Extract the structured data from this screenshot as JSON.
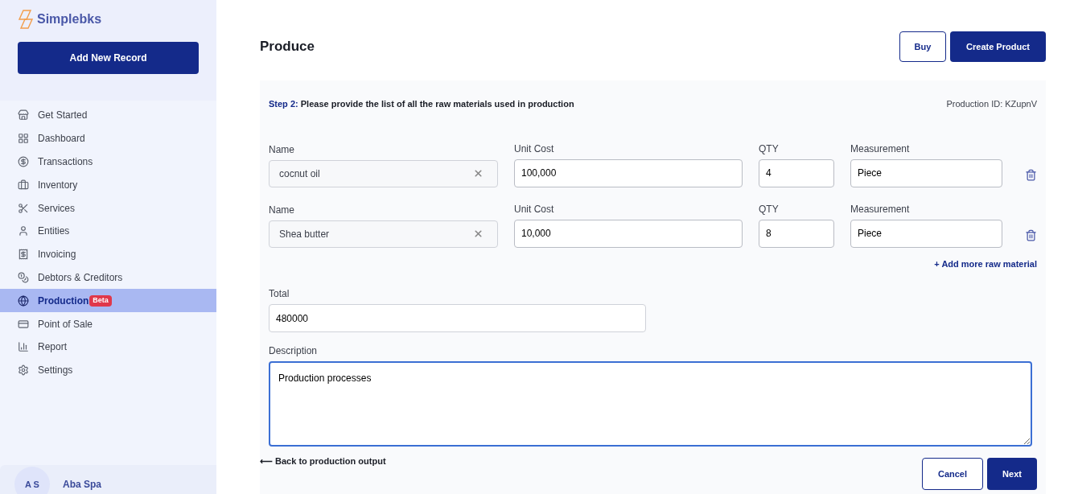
{
  "sidebar": {
    "brand": "Simplebks",
    "add_button": "Add New Record",
    "items": [
      {
        "label": "Get Started",
        "selected": false
      },
      {
        "label": "Dashboard",
        "selected": false
      },
      {
        "label": "Transactions",
        "selected": false
      },
      {
        "label": "Inventory",
        "selected": false
      },
      {
        "label": "Services",
        "selected": false
      },
      {
        "label": "Entities",
        "selected": false
      },
      {
        "label": "Invoicing",
        "selected": false
      },
      {
        "label": "Debtors & Creditors",
        "selected": false
      },
      {
        "label": "Production",
        "selected": true,
        "badge": "Beta"
      },
      {
        "label": "Point of Sale",
        "selected": false
      },
      {
        "label": "Report",
        "selected": false
      },
      {
        "label": "Settings",
        "selected": false
      }
    ],
    "user": {
      "initials": "A S",
      "name": "Aba Spa"
    }
  },
  "header": {
    "title": "Produce",
    "buttons": [
      "Buy",
      "Create Product"
    ]
  },
  "form": {
    "step_label": "Step 2:",
    "instruction": "Please provide the list of all the raw materials used in production",
    "production_id": "Production ID: KZupnV",
    "materials": [
      {
        "name_label": "Name",
        "name": "cocnut oil",
        "unit_cost_label": "Unit Cost",
        "unit_cost": "100,000",
        "qty_label": "QTY",
        "qty": "4",
        "measurement_label": "Measurement",
        "measurement": "Piece"
      },
      {
        "name_label": "Name",
        "name": "Shea butter",
        "unit_cost_label": "Unit Cost",
        "unit_cost": "10,000",
        "qty_label": "QTY",
        "qty": "8",
        "measurement_label": "Measurement",
        "measurement": "Piece"
      }
    ],
    "add_more": "+ Add more raw material",
    "total_label": "Total",
    "total": "480000",
    "description_label": "Description",
    "description": "Production processes",
    "back_link": "⟵ Back to production output",
    "actions": [
      "Cancel",
      "Next"
    ]
  }
}
